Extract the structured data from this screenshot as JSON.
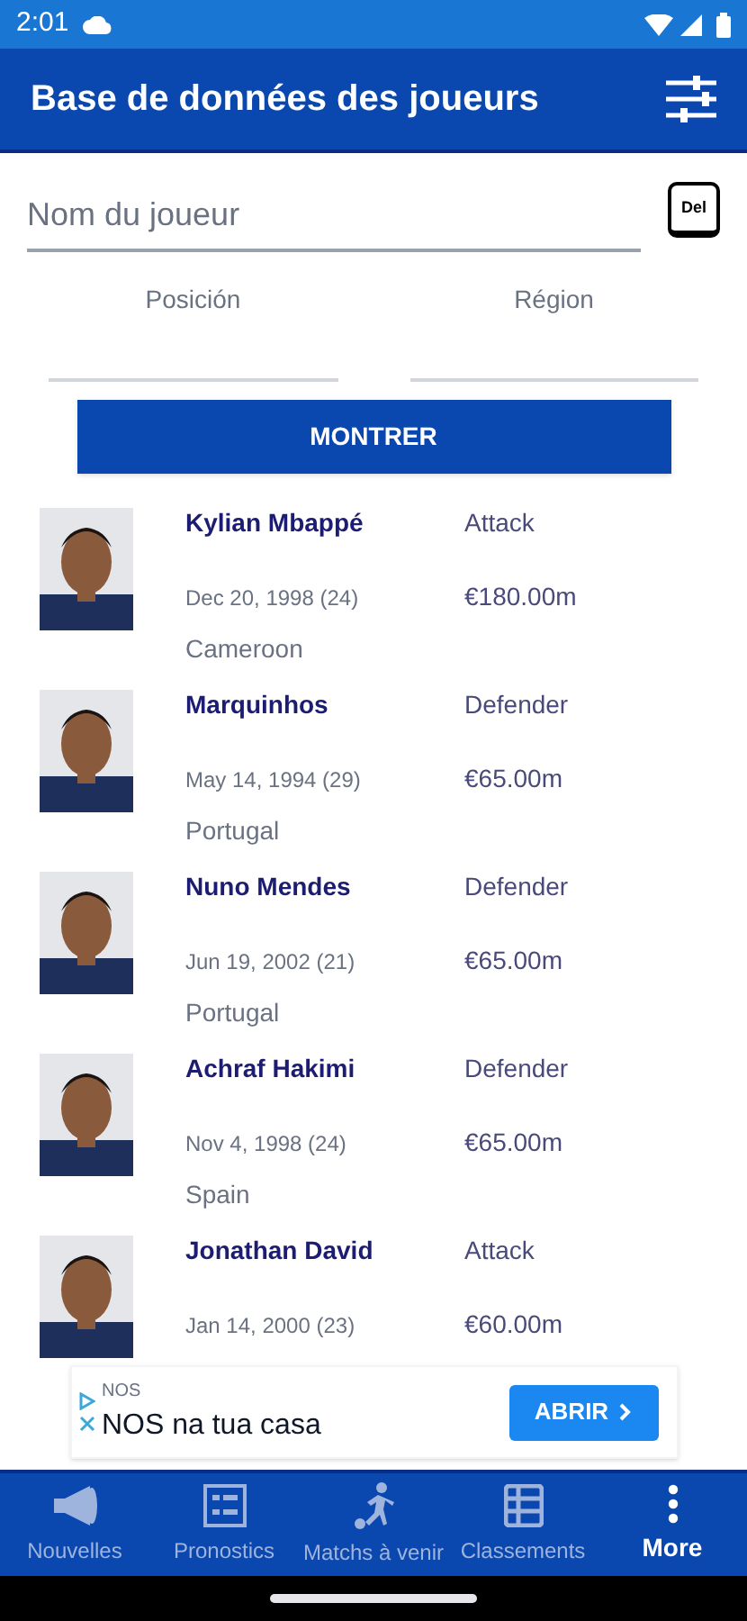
{
  "status_bar": {
    "time": "2:01"
  },
  "app_bar": {
    "title": "Base de données des joueurs"
  },
  "search": {
    "placeholder": "Nom du joueur",
    "clear_label": "Del"
  },
  "filters": [
    {
      "label": "Posición"
    },
    {
      "label": "Région"
    }
  ],
  "show_button": "MONTRER",
  "players": [
    {
      "name": "Kylian Mbappé",
      "position": "Attack",
      "birth": "Dec 20, 1998 (24)",
      "value": "€180.00m",
      "country": "Cameroon"
    },
    {
      "name": "Marquinhos",
      "position": "Defender",
      "birth": "May 14, 1994 (29)",
      "value": "€65.00m",
      "country": "Portugal"
    },
    {
      "name": "Nuno Mendes",
      "position": "Defender",
      "birth": "Jun 19, 2002 (21)",
      "value": "€65.00m",
      "country": "Portugal"
    },
    {
      "name": "Achraf Hakimi",
      "position": "Defender",
      "birth": "Nov 4, 1998 (24)",
      "value": "€65.00m",
      "country": "Spain"
    },
    {
      "name": "Jonathan David",
      "position": "Attack",
      "birth": "Jan 14, 2000 (23)",
      "value": "€60.00m"
    }
  ],
  "ad": {
    "advertiser": "NOS",
    "headline": "NOS na tua casa",
    "button": "ABRIR"
  },
  "bottom_nav": [
    {
      "label": "Nouvelles",
      "kind": "megaphone",
      "selected": false
    },
    {
      "label": "Pronostics",
      "kind": "list",
      "selected": false
    },
    {
      "label": "Matchs à venir",
      "kind": "player",
      "selected": false
    },
    {
      "label": "Classements",
      "kind": "table",
      "selected": false
    },
    {
      "label": "More",
      "kind": "more",
      "selected": true
    }
  ]
}
